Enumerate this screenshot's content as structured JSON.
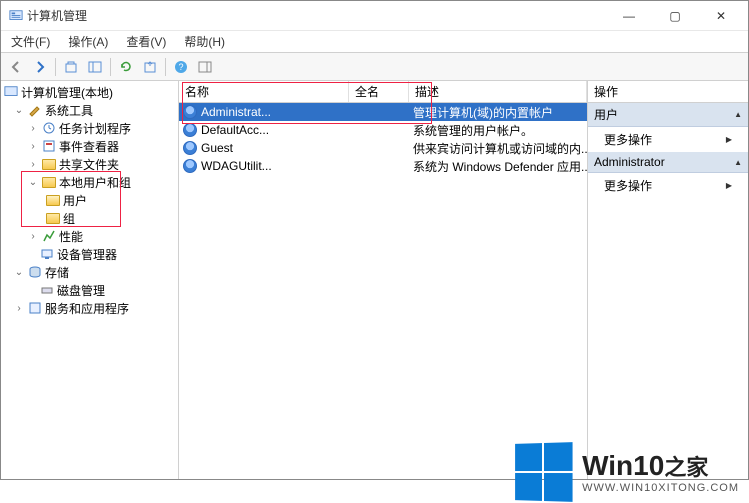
{
  "window": {
    "title": "计算机管理",
    "controls": {
      "min": "—",
      "max": "▢",
      "close": "✕"
    }
  },
  "menu": {
    "file": "文件(F)",
    "action": "操作(A)",
    "view": "查看(V)",
    "help": "帮助(H)"
  },
  "toolbar_icons": [
    "back",
    "forward",
    "up",
    "pane",
    "refresh",
    "export",
    "help"
  ],
  "tree": {
    "root": "计算机管理(本地)",
    "system_tools": "系统工具",
    "task_scheduler": "任务计划程序",
    "event_viewer": "事件查看器",
    "shared_folders": "共享文件夹",
    "local_users_groups": "本地用户和组",
    "users": "用户",
    "groups": "组",
    "performance": "性能",
    "device_manager": "设备管理器",
    "storage": "存储",
    "disk_mgmt": "磁盘管理",
    "services_apps": "服务和应用程序"
  },
  "list": {
    "columns": {
      "name": "名称",
      "fullname": "全名",
      "desc": "描述"
    },
    "rows": [
      {
        "name": "Administrat...",
        "fullname": "",
        "desc": "管理计算机(域)的内置帐户",
        "selected": true
      },
      {
        "name": "DefaultAcc...",
        "fullname": "",
        "desc": "系统管理的用户帐户。"
      },
      {
        "name": "Guest",
        "fullname": "",
        "desc": "供来宾访问计算机或访问域的内..."
      },
      {
        "name": "WDAGUtilit...",
        "fullname": "",
        "desc": "系统为 Windows Defender 应用..."
      }
    ]
  },
  "actions": {
    "header": "操作",
    "sec1": "用户",
    "more1": "更多操作",
    "sec2": "Administrator",
    "more2": "更多操作"
  },
  "watermark": {
    "brand": "Win10",
    "suffix": "之家",
    "url": "WWW.WIN10XITONG.COM"
  }
}
